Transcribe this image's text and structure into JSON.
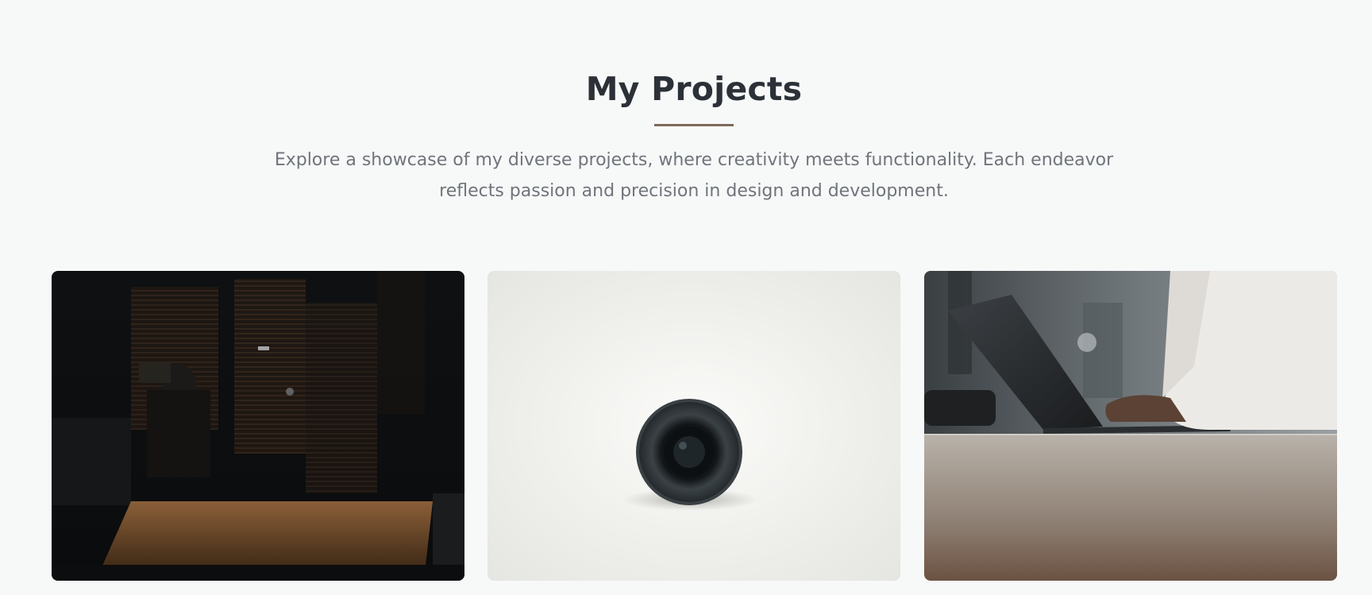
{
  "section": {
    "title": "My Projects",
    "description": "Explore a showcase of my diverse projects, where creativity meets functionality. Each endeavor reflects passion and precision in design and development."
  },
  "projects": [
    {
      "image": "studio-camera-operator-photo"
    },
    {
      "image": "camera-lens-photo"
    },
    {
      "image": "laptop-typing-photo"
    }
  ],
  "colors": {
    "background": "#f7f8f8",
    "title": "#2b3137",
    "accent_underline": "#7d6a5c",
    "description": "#6f757b"
  }
}
